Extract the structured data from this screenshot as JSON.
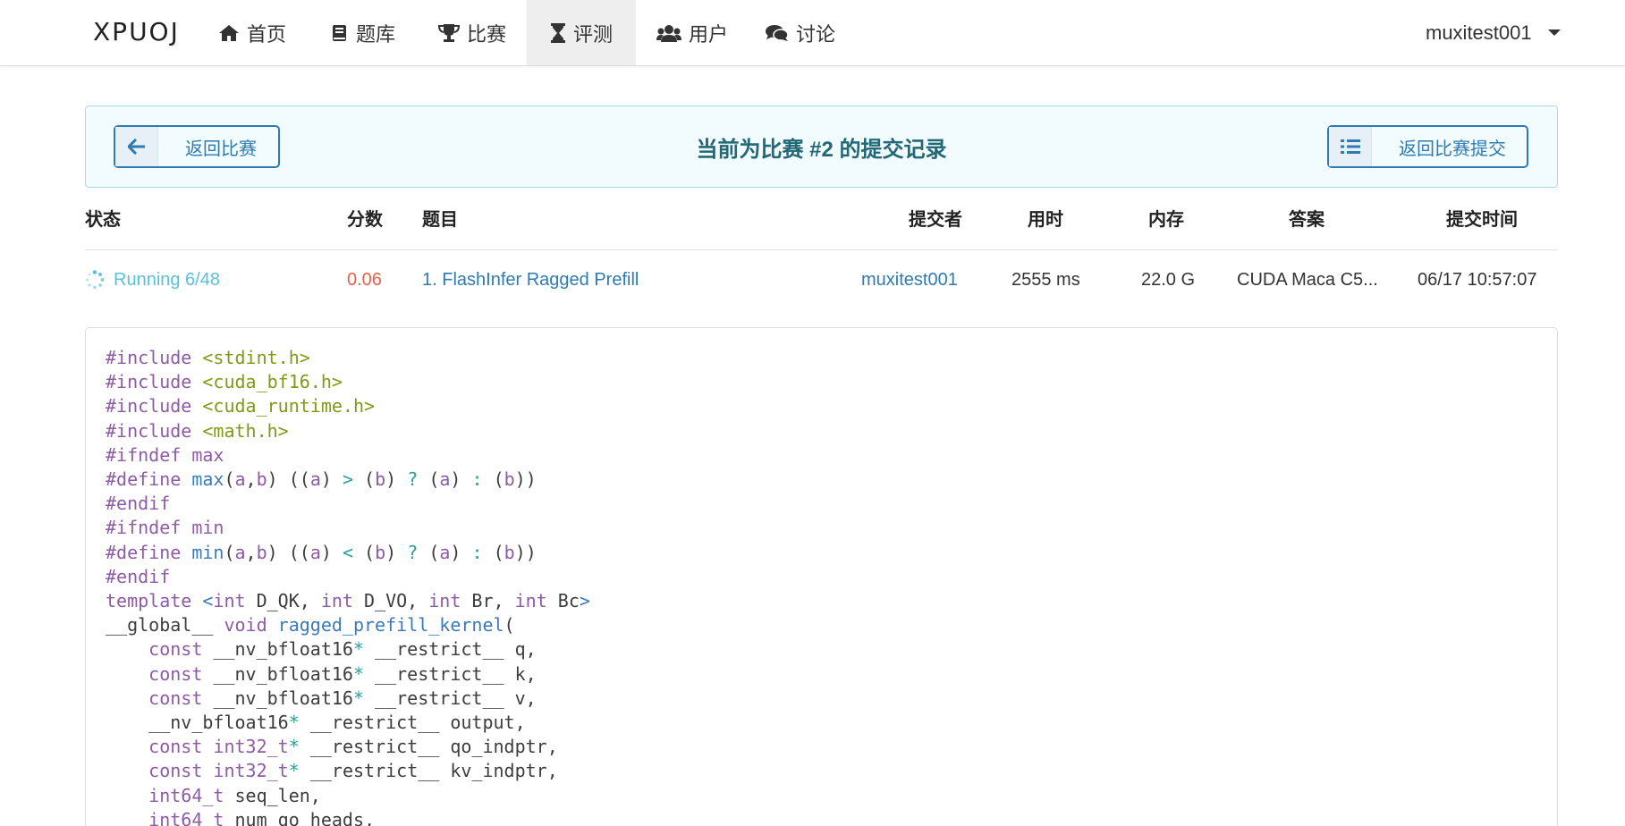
{
  "nav": {
    "brand": "XPUOJ",
    "items": [
      {
        "label": "首页",
        "icon": "home-icon"
      },
      {
        "label": "题库",
        "icon": "book-icon"
      },
      {
        "label": "比赛",
        "icon": "trophy-icon"
      },
      {
        "label": "评测",
        "icon": "hourglass-icon",
        "active": true
      },
      {
        "label": "用户",
        "icon": "users-icon"
      },
      {
        "label": "讨论",
        "icon": "comments-icon"
      }
    ],
    "user": "muxitest001"
  },
  "header": {
    "back_button": "返回比赛",
    "title": "当前为比赛 #2 的提交记录",
    "submissions_button": "返回比赛提交"
  },
  "table": {
    "columns": [
      "状态",
      "分数",
      "题目",
      "提交者",
      "用时",
      "内存",
      "答案",
      "提交时间"
    ],
    "row": {
      "status": "Running 6/48",
      "score": "0.06",
      "problem": "1. FlashInfer Ragged Prefill",
      "submitter": "muxitest001",
      "time": "2555 ms",
      "memory": "22.0 G",
      "answer": "CUDA Maca C5...",
      "submit_time": "06/17  10:57:07"
    }
  },
  "colors": {
    "accent": "#2e7bb2",
    "running": "#5bc0de",
    "score": "#e8604c",
    "panel_bg": "#f2fbfd",
    "panel_title": "#226877"
  },
  "code": {
    "lines": [
      [
        [
          "kw",
          "#include "
        ],
        [
          "str",
          "<stdint.h>"
        ]
      ],
      [
        [
          "kw",
          "#include "
        ],
        [
          "str",
          "<cuda_bf16.h>"
        ]
      ],
      [
        [
          "kw",
          "#include "
        ],
        [
          "str",
          "<cuda_runtime.h>"
        ]
      ],
      [
        [
          "kw",
          "#include "
        ],
        [
          "str",
          "<math.h>"
        ]
      ],
      [
        [
          "kw",
          "#ifndef max"
        ]
      ],
      [
        [
          "kw",
          "#define "
        ],
        [
          "fn",
          "max"
        ],
        [
          "pl",
          "("
        ],
        [
          "ar",
          "a"
        ],
        [
          "pl",
          ","
        ],
        [
          "ar",
          "b"
        ],
        [
          "pl",
          ") (("
        ],
        [
          "ar",
          "a"
        ],
        [
          "pl",
          ") "
        ],
        [
          "op",
          ">"
        ],
        [
          "pl",
          " ("
        ],
        [
          "ar",
          "b"
        ],
        [
          "pl",
          ") "
        ],
        [
          "op",
          "?"
        ],
        [
          "pl",
          " ("
        ],
        [
          "ar",
          "a"
        ],
        [
          "pl",
          ") "
        ],
        [
          "op",
          ":"
        ],
        [
          "pl",
          " ("
        ],
        [
          "ar",
          "b"
        ],
        [
          "pl",
          "))"
        ]
      ],
      [
        [
          "kw",
          "#endif"
        ]
      ],
      [
        [
          "kw",
          "#ifndef min"
        ]
      ],
      [
        [
          "kw",
          "#define "
        ],
        [
          "fn",
          "min"
        ],
        [
          "pl",
          "("
        ],
        [
          "ar",
          "a"
        ],
        [
          "pl",
          ","
        ],
        [
          "ar",
          "b"
        ],
        [
          "pl",
          ") (("
        ],
        [
          "ar",
          "a"
        ],
        [
          "pl",
          ") "
        ],
        [
          "op",
          "<"
        ],
        [
          "pl",
          " ("
        ],
        [
          "ar",
          "b"
        ],
        [
          "pl",
          ") "
        ],
        [
          "op",
          "?"
        ],
        [
          "pl",
          " ("
        ],
        [
          "ar",
          "a"
        ],
        [
          "pl",
          ") "
        ],
        [
          "op",
          ":"
        ],
        [
          "pl",
          " ("
        ],
        [
          "ar",
          "b"
        ],
        [
          "pl",
          "))"
        ]
      ],
      [
        [
          "kw",
          "#endif"
        ]
      ],
      [
        [
          "kw",
          "template "
        ],
        [
          "fn",
          "<"
        ],
        [
          "kw",
          "int"
        ],
        [
          "pl",
          " D_QK, "
        ],
        [
          "kw",
          "int"
        ],
        [
          "pl",
          " D_VO, "
        ],
        [
          "kw",
          "int"
        ],
        [
          "pl",
          " Br, "
        ],
        [
          "kw",
          "int"
        ],
        [
          "pl",
          " Bc"
        ],
        [
          "fn",
          ">"
        ]
      ],
      [
        [
          "pl",
          "__global__ "
        ],
        [
          "kw",
          "void "
        ],
        [
          "fn",
          "ragged_prefill_kernel"
        ],
        [
          "pl",
          "("
        ]
      ],
      [
        [
          "pl",
          "    "
        ],
        [
          "kw",
          "const"
        ],
        [
          "pl",
          " __nv_bfloat16"
        ],
        [
          "op",
          "*"
        ],
        [
          "pl",
          " __restrict__ q,"
        ]
      ],
      [
        [
          "pl",
          "    "
        ],
        [
          "kw",
          "const"
        ],
        [
          "pl",
          " __nv_bfloat16"
        ],
        [
          "op",
          "*"
        ],
        [
          "pl",
          " __restrict__ k,"
        ]
      ],
      [
        [
          "pl",
          "    "
        ],
        [
          "kw",
          "const"
        ],
        [
          "pl",
          " __nv_bfloat16"
        ],
        [
          "op",
          "*"
        ],
        [
          "pl",
          " __restrict__ v,"
        ]
      ],
      [
        [
          "pl",
          "    __nv_bfloat16"
        ],
        [
          "op",
          "*"
        ],
        [
          "pl",
          " __restrict__ output,"
        ]
      ],
      [
        [
          "pl",
          "    "
        ],
        [
          "kw",
          "const"
        ],
        [
          "pl",
          " "
        ],
        [
          "kw",
          "int32_t"
        ],
        [
          "op",
          "*"
        ],
        [
          "pl",
          " __restrict__ qo_indptr,"
        ]
      ],
      [
        [
          "pl",
          "    "
        ],
        [
          "kw",
          "const"
        ],
        [
          "pl",
          " "
        ],
        [
          "kw",
          "int32_t"
        ],
        [
          "op",
          "*"
        ],
        [
          "pl",
          " __restrict__ kv_indptr,"
        ]
      ],
      [
        [
          "pl",
          "    "
        ],
        [
          "kw",
          "int64_t"
        ],
        [
          "pl",
          " seq_len,"
        ]
      ],
      [
        [
          "pl",
          "    "
        ],
        [
          "kw",
          "int64_t"
        ],
        [
          "pl",
          " num_qo_heads,"
        ]
      ]
    ]
  }
}
